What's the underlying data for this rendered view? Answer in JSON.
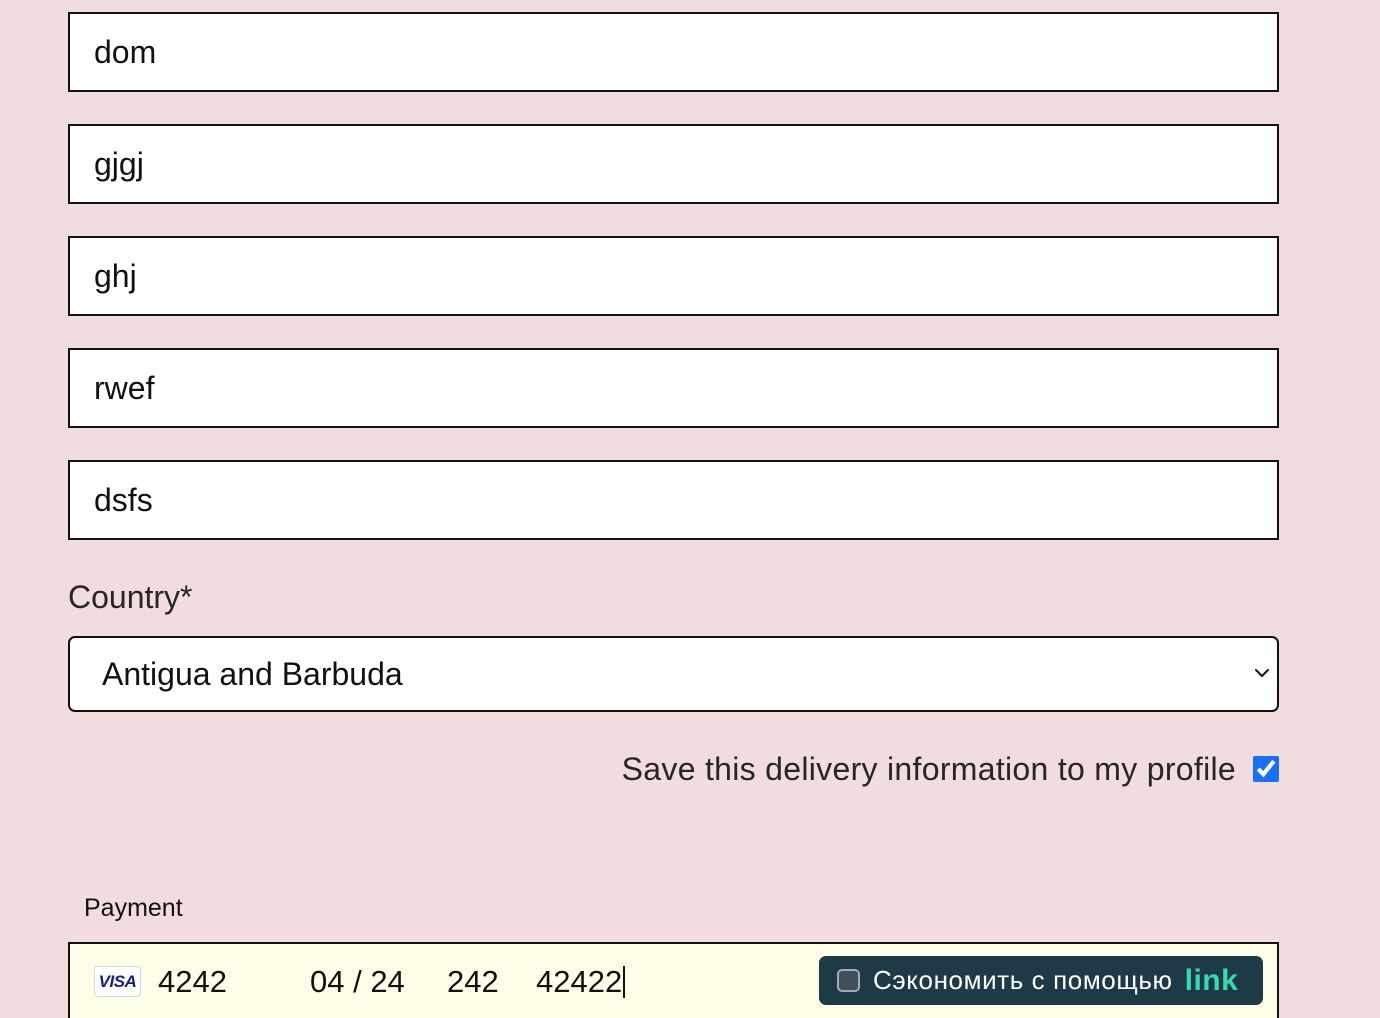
{
  "form": {
    "address_fields": [
      {
        "value": "dom"
      },
      {
        "value": "gjgj"
      },
      {
        "value": "ghj"
      },
      {
        "value": "rwef"
      },
      {
        "value": "dsfs"
      }
    ],
    "country": {
      "label": "Country*",
      "selected": "Antigua and Barbuda"
    },
    "save_delivery": {
      "label": "Save this delivery information to my profile",
      "checked": true
    }
  },
  "payment": {
    "label": "Payment",
    "card_brand": "VISA",
    "card_number": "4242",
    "expiry": "04 / 24",
    "cvc": "242",
    "postal_code": "42422",
    "link": {
      "label": "Сэкономить с помощью",
      "logo_text": "link",
      "checked": false
    }
  },
  "icons": {
    "country_select": "chevron-down-icon",
    "card_brand": "visa-card-icon",
    "link_logo": "link-logo-icon"
  },
  "colors": {
    "page_bg": "#f1dcde",
    "border": "#111111",
    "payment_bg": "#fefde8",
    "checkbox_blue": "#1b6ff5",
    "link_button_bg": "#1f3a47",
    "link_green": "#37dcae",
    "visa_blue": "#1a1f71"
  }
}
